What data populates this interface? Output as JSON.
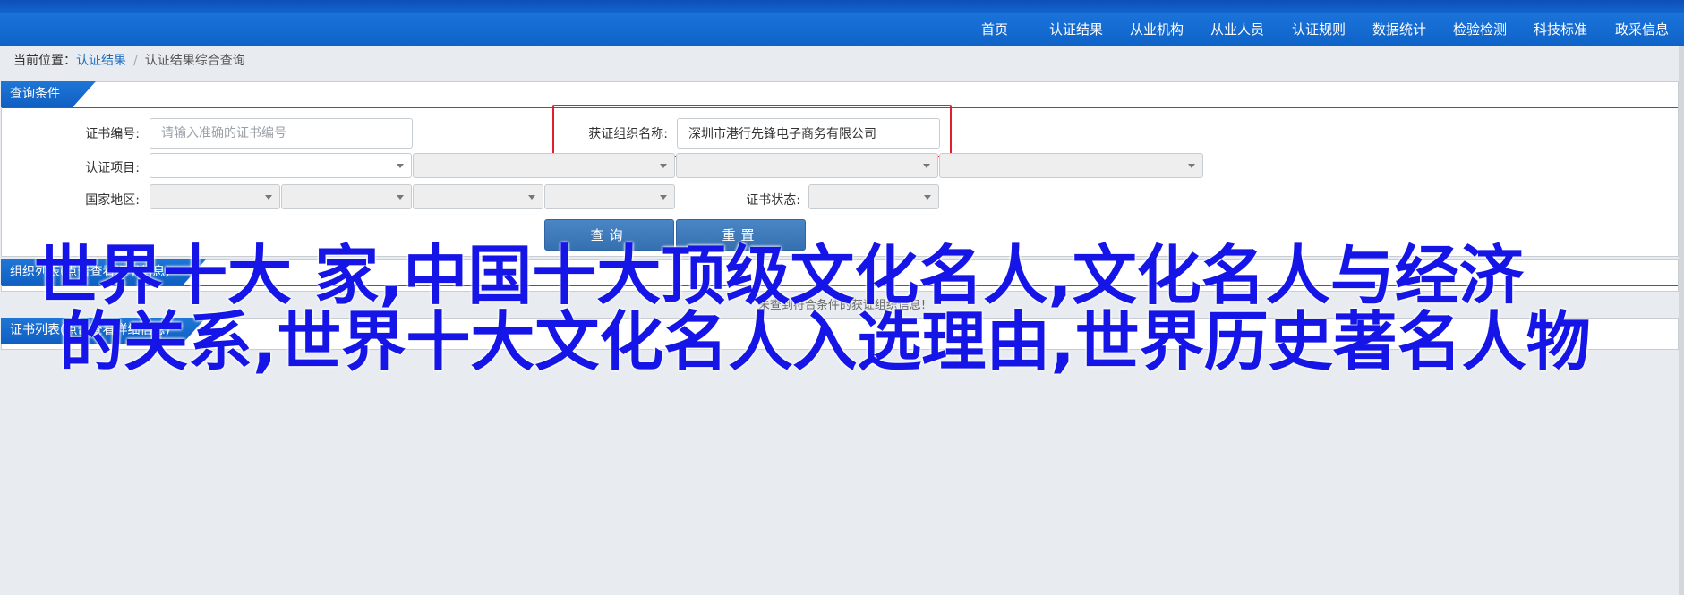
{
  "nav": {
    "items": [
      "首页",
      "认证结果",
      "从业机构",
      "从业人员",
      "认证规则",
      "数据统计",
      "检验检测",
      "科技标准",
      "政采信息"
    ]
  },
  "breadcrumb": {
    "prefix": "当前位置：",
    "link": "认证结果",
    "separator": "/",
    "current": "认证结果综合查询"
  },
  "query_panel": {
    "title": "查询条件",
    "cert_no_label": "证书编号:",
    "cert_no_placeholder": "请输入准确的证书编号",
    "org_label": "获证组织名称:",
    "org_value": "深圳市港行先锋电子商务有限公司",
    "project_label": "认证项目:",
    "region_label": "国家地区:",
    "status_label": "证书状态:",
    "search_button": "查询",
    "reset_button": "重置"
  },
  "org_panel": {
    "title": "组织列表(点击查看证书信息)",
    "empty_message": "未查到符合条件的获证组织信息!"
  },
  "cert_panel": {
    "title": "证书列表(点击查看详细信息)"
  },
  "overlay": {
    "line1": "世界十大  家,中国十大顶级文化名人,文化名人与经济",
    "line2": "的关系,世界十大文化名人入选理由,世界历史著名人物"
  },
  "colors": {
    "nav_bg": "#1a73d9",
    "accent": "#1667c9",
    "highlight": "#e0202a",
    "overlay_text": "#1515e8"
  }
}
